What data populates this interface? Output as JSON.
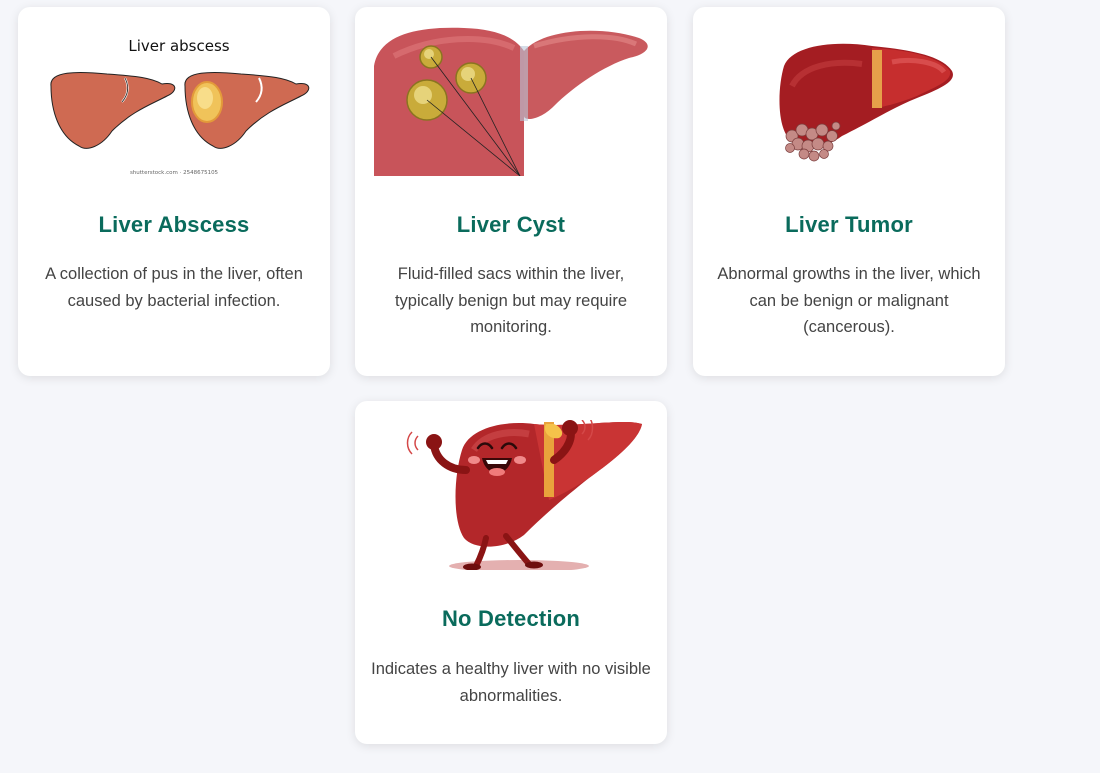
{
  "cards": [
    {
      "title": "Liver Abscess",
      "description": "A collection of pus in the liver, often caused by bacterial infection.",
      "image": {
        "icon": "liver-abscess-illustration",
        "caption": "Liver abscess",
        "credit": "shutterstock.com · 2548675105"
      }
    },
    {
      "title": "Liver Cyst",
      "description": "Fluid-filled sacs within the liver, typically benign but may require monitoring.",
      "image": {
        "icon": "liver-cyst-illustration"
      }
    },
    {
      "title": "Liver Tumor",
      "description": "Abnormal growths in the liver, which can be benign or malignant (cancerous).",
      "image": {
        "icon": "liver-tumor-illustration"
      }
    },
    {
      "title": "No Detection",
      "description": "Indicates a healthy liver with no visible abnormalities.",
      "image": {
        "icon": "healthy-liver-mascot-illustration"
      }
    }
  ],
  "colors": {
    "title": "#0a6b5c",
    "text": "#444444",
    "background": "#f5f6fa",
    "card": "#ffffff"
  }
}
